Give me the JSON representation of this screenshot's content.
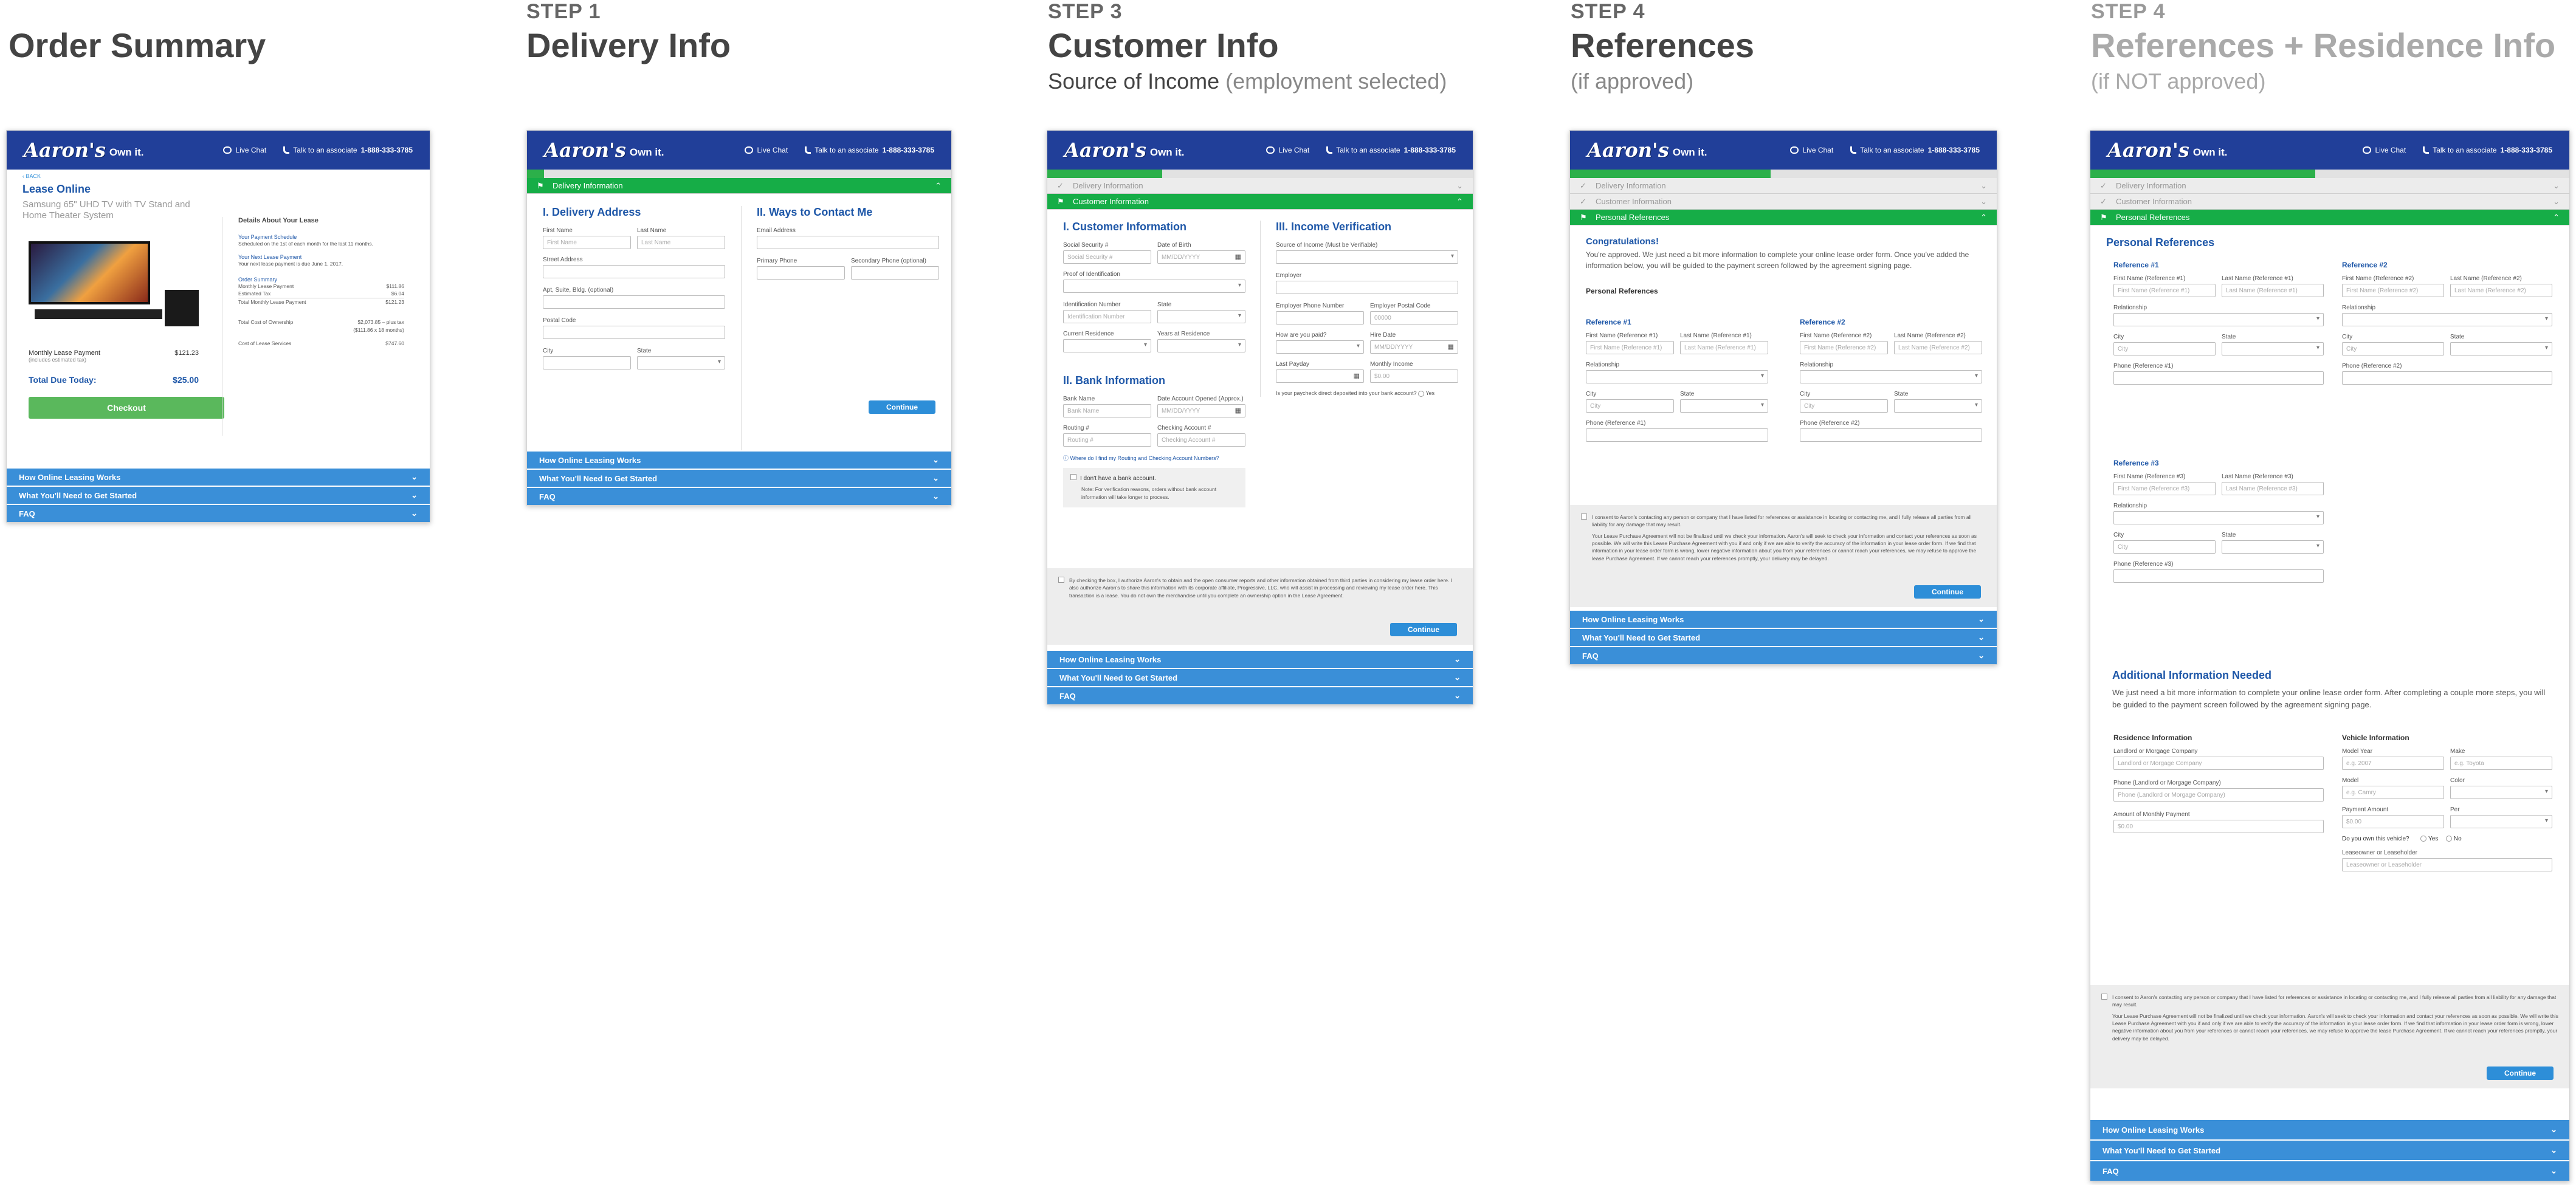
{
  "brand": {
    "logo": "Aaron's",
    "tagline": "Own it.",
    "live_chat": "Live Chat",
    "talk_prefix": "Talk to an associate",
    "phone": "1-888-333-3785"
  },
  "footer": {
    "how": "How Online Leasing Works",
    "started": "What You'll Need to Get Started",
    "faq": "FAQ"
  },
  "cols": {
    "c1": {
      "title": "Order Summary"
    },
    "c2": {
      "step": "STEP 1",
      "title": "Delivery Info"
    },
    "c3": {
      "step": "STEP 3",
      "title": "Customer Info",
      "sub1": "Source of Income",
      "sub2": "(employment selected)"
    },
    "c4": {
      "step": "STEP 4",
      "title": "References",
      "sub": "(if approved)"
    },
    "c5": {
      "step": "STEP 4",
      "title": "References + Residence Info",
      "sub": "(if NOT approved)"
    }
  },
  "order": {
    "back": "‹ BACK",
    "title": "Lease Online",
    "product": "Samsung 65\" UHD TV with TV Stand and Home Theater System",
    "details_title": "Details About Your Lease",
    "schedule_t": "Your Payment Schedule",
    "schedule_d": "Scheduled on the 1st of each month for the last 11 months.",
    "next_t": "Your Next Lease Payment",
    "next_d": "Your next lease payment is due June 1, 2017.",
    "summary_t": "Order Summary",
    "rows": [
      [
        "Monthly Lease Payment",
        "$111.86"
      ],
      [
        "Estimated Tax",
        "$6.04"
      ],
      [
        "Total Monthly Lease Payment",
        "$121.23"
      ]
    ],
    "tco_label": "Total Cost of Ownership",
    "tco_val": "$2,073.85 – plus tax",
    "tco_sub": "($111.86 x 18 months)",
    "col_label": "Cost of Lease Services",
    "col_val": "$747.60",
    "monthly_label": "Monthly Lease Payment",
    "monthly_sub": "(includes estimated tax)",
    "monthly_val": "$121.23",
    "total_label": "Total Due Today:",
    "total_val": "$25.00",
    "checkout": "Checkout"
  },
  "delivery": {
    "section_bar": "Delivery Information",
    "h1": "I. Delivery Address",
    "h2": "II. Ways to Contact Me",
    "first": "First Name",
    "last": "Last Name",
    "first_ph": "First Name",
    "last_ph": "Last Name",
    "street": "Street Address",
    "apt": "Apt, Suite, Bldg. (optional)",
    "postal": "Postal Code",
    "city": "City",
    "state": "State",
    "email": "Email Address",
    "primary": "Primary Phone",
    "secondary": "Secondary Phone (optional)",
    "continue": "Continue"
  },
  "customer": {
    "done_bar": "Delivery Information",
    "section_bar": "Customer Information",
    "h1": "I. Customer Information",
    "h2": "III. Income Verification",
    "h3": "II. Bank Information",
    "ssn": "Social Security #",
    "ssn_ph": "Social Security #",
    "dob": "Date of Birth",
    "dob_ph": "MM/DD/YYYY",
    "proof": "Proof of Identification",
    "idnum": "Identification Number",
    "idnum_ph": "Identification Number",
    "state": "State",
    "residence": "Current Residence",
    "years": "Years at Residence",
    "source": "Source of Income (Must be Verifiable)",
    "employer": "Employer",
    "emp_phone": "Employer Phone Number",
    "emp_postal": "Employer Postal Code",
    "emp_postal_ph": "00000",
    "paid": "How are you paid?",
    "hire": "Hire Date",
    "hire_ph": "MM/DD/YYYY",
    "lastpay": "Last Payday",
    "income": "Monthly Income",
    "income_ph": "$0.00",
    "deposit_q": "Is your paycheck direct deposited into your bank account?",
    "yes": "Yes",
    "bankname": "Bank Name",
    "bankname_ph": "Bank Name",
    "opened": "Date Account Opened (Approx.)",
    "opened_ph": "MM/DD/YYYY",
    "routing": "Routing #",
    "routing_ph": "Routing #",
    "checking": "Checking Account #",
    "checking_ph": "Checking Account #",
    "where": "Where do I find my Routing and Checking Account Numbers?",
    "nobank": "I don't have a bank account.",
    "nobank_note": "Note: For verification reasons, orders without bank account information will take longer to process.",
    "consent": "By checking the box, I authorize Aaron's to obtain and the open consumer reports and other information obtained from third parties in considering my lease order here. I also authorize Aaron's to share this information with its corporate affiliate, Progressive, LLC, who will assist in processing and reviewing my lease order here. This transaction is a lease. You do not own the merchandise until you complete an ownership option in the Lease Agreement.",
    "continue": "Continue"
  },
  "refs": {
    "done1": "Delivery Information",
    "done2": "Customer Information",
    "section_bar": "Personal References",
    "congrats": "Congratulations!",
    "congrats_text": "You're approved. We just need a bit more information to complete your online lease order form. Once you've added the information below, you will be guided to the payment screen followed by the agreement signing page.",
    "pr": "Personal References",
    "r1": "Reference #1",
    "r2": "Reference #2",
    "r3": "Reference #3",
    "fn1": "First Name (Reference #1)",
    "ln1": "Last Name (Reference #1)",
    "fn2": "First Name (Reference #2)",
    "ln2": "Last Name (Reference #2)",
    "fn3": "First Name (Reference #3)",
    "ln3": "Last Name (Reference #3)",
    "rel": "Relationship",
    "city": "City",
    "state": "State",
    "ph1": "Phone (Reference #1)",
    "ph2": "Phone (Reference #2)",
    "ph3": "Phone (Reference #3)",
    "consent1": "I consent to Aaron's contacting any person or company that I have listed for references or assistance in locating or contacting me, and I fully release all parties from all liability for any damage that may result.",
    "consent2": "Your Lease Purchase Agreement will not be finalized until we check your information. Aaron's will seek to check your information and contact your references as soon as possible. We will write this Lease Purchase Agreement with you if and only if we are able to verify the accuracy of the information in your lease order form. If we find that information in your lease order form is wrong, lower negative information about you from your references or cannot reach your references, we may refuse to approve the lease Purchase Agreement. If we cannot reach your references promptly, your delivery may be delayed.",
    "continue": "Continue"
  },
  "resid": {
    "pr": "Personal References",
    "add_h": "Additional Information Needed",
    "add_t": "We just need a bit more information to complete your online lease order form. After completing a couple more steps, you will be guided to the payment screen followed by the agreement signing page.",
    "res_h": "Residence Information",
    "veh_h": "Vehicle Information",
    "landlord": "Landlord or Morgage Company",
    "landlord_ph": "Landlord or Morgage Company",
    "phone": "Phone (Landlord or Morgage Company)",
    "phone_ph": "Phone (Landlord or Morgage Company)",
    "amount": "Amount of Monthly Payment",
    "amount_ph": "$0.00",
    "year": "Model Year",
    "year_ph": "e.g. 2007",
    "make": "Make",
    "make_ph": "e.g. Toyota",
    "model": "Model",
    "model_ph": "e.g. Camry",
    "color": "Color",
    "payamt": "Payment Amount",
    "payamt_ph": "$0.00",
    "per": "Per",
    "own_q": "Do you own this vehicle?",
    "yes": "Yes",
    "no": "No",
    "lessor": "Leaseowner or Leaseholder",
    "lessor_ph": "Leaseowner or Leaseholder"
  }
}
